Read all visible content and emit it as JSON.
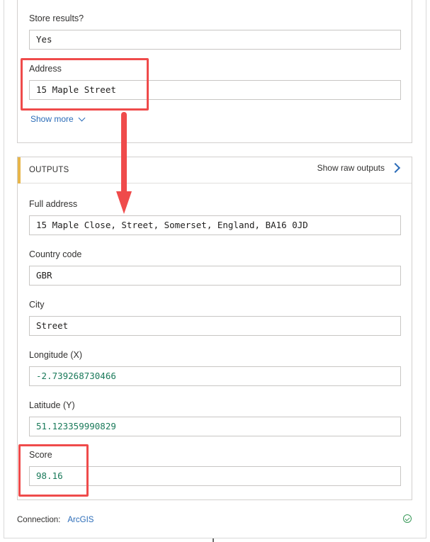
{
  "inputs": {
    "fields": [
      {
        "label": "Store results?",
        "value": "Yes"
      },
      {
        "label": "Address",
        "value": "15 Maple Street"
      }
    ],
    "show_more": "Show more"
  },
  "outputs": {
    "title": "OUTPUTS",
    "raw_link": "Show raw outputs",
    "fields": [
      {
        "label": "Full address",
        "value": "15 Maple Close, Street, Somerset, England, BA16 0JD"
      },
      {
        "label": "Country code",
        "value": "GBR"
      },
      {
        "label": "City",
        "value": "Street"
      },
      {
        "label": "Longitude (X)",
        "value": "-2.739268730466"
      },
      {
        "label": "Latitude (Y)",
        "value": "51.123359990829"
      },
      {
        "label": "Score",
        "value": "98.16"
      }
    ]
  },
  "footer": {
    "connection_label": "Connection:",
    "connection_name": "ArcGIS",
    "status_icon": "check-circle-icon"
  },
  "colors": {
    "accent": "#e8b64a",
    "link": "#2b6cb8",
    "annotation": "#ef4b4b",
    "numeric_value": "#1a7a5a"
  }
}
